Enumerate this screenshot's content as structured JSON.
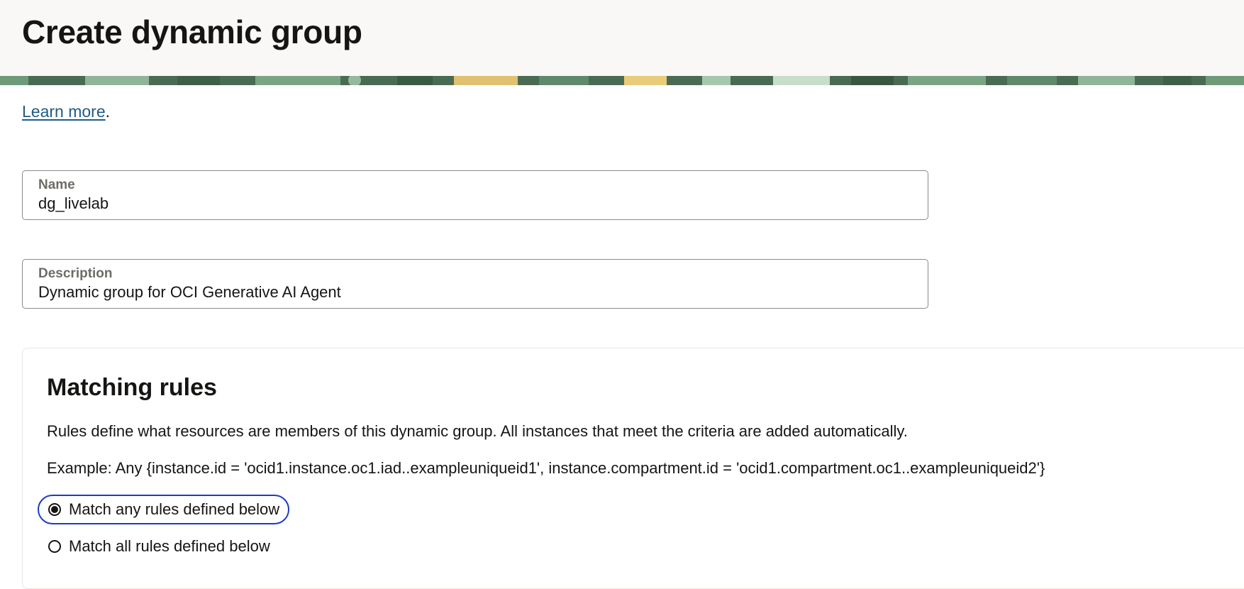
{
  "header": {
    "title": "Create dynamic group"
  },
  "intro": {
    "learn_more_label": "Learn more",
    "trailing_period": "."
  },
  "form": {
    "name": {
      "label": "Name",
      "value": "dg_livelab"
    },
    "description": {
      "label": "Description",
      "value": "Dynamic group for OCI Generative AI Agent"
    }
  },
  "matching_rules": {
    "title": "Matching rules",
    "description": "Rules define what resources are members of this dynamic group. All instances that meet the criteria are added automatically.",
    "example": "Example: Any {instance.id = 'ocid1.instance.oc1.iad..exampleuniqueid1', instance.compartment.id = 'ocid1.compartment.oc1..exampleuniqueid2'}",
    "options": [
      {
        "label": "Match any rules defined below",
        "selected": true
      },
      {
        "label": "Match all rules defined below",
        "selected": false
      }
    ]
  },
  "colors": {
    "link": "#1e5b88",
    "focus_ring": "#1f3bc4",
    "header_bg": "#f9f8f6",
    "banner_base": "#4a6b52"
  }
}
